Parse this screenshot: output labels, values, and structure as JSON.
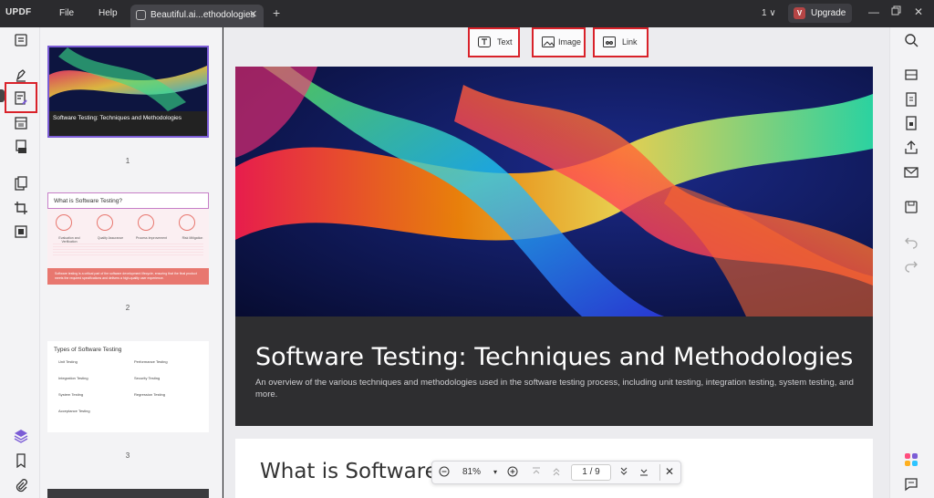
{
  "app": {
    "logo": "UPDF",
    "menu": [
      "File",
      "Help"
    ],
    "tab_title": "Beautiful.ai...ethodologies",
    "page_count": "1 ∨",
    "upgrade_label": "Upgrade",
    "avatar_letter": "V"
  },
  "edit_toolbar": {
    "text_label": "Text",
    "image_label": "Image",
    "link_label": "Link"
  },
  "thumbnails": [
    {
      "number": "1",
      "title": "Software Testing: Techniques and Methodologies"
    },
    {
      "number": "2",
      "title": "What is Software Testing?",
      "cards": [
        {
          "heading": "Evaluation and Verification"
        },
        {
          "heading": "Quality Assurance"
        },
        {
          "heading": "Process Improvement"
        },
        {
          "heading": "Risk Mitigation"
        }
      ],
      "footer": "Software testing is a critical part of the software development lifecycle, ensuring that the final product meets the required specifications and delivers a high-quality user experience."
    },
    {
      "number": "3",
      "title": "Types of Software Testing",
      "left_items": [
        "Unit Testing",
        "Integration Testing",
        "System Testing",
        "Acceptance Testing"
      ],
      "right_items": [
        "Performance Testing",
        "Security Testing",
        "Regression Testing"
      ]
    }
  ],
  "document": {
    "page1_title": "Software Testing: Techniques and Methodologies",
    "page1_subtitle": "An overview of the various techniques and methodologies used in the software testing process, including unit testing, integration testing, system testing, and more.",
    "page2_title": "What is Software T"
  },
  "navbar": {
    "zoom": "81%",
    "page_display": "1 / 9"
  },
  "colors": {
    "highlight_red": "#d9222a",
    "accent_purple": "#7b5cd6",
    "thumb2_accent": "#e8776f"
  }
}
